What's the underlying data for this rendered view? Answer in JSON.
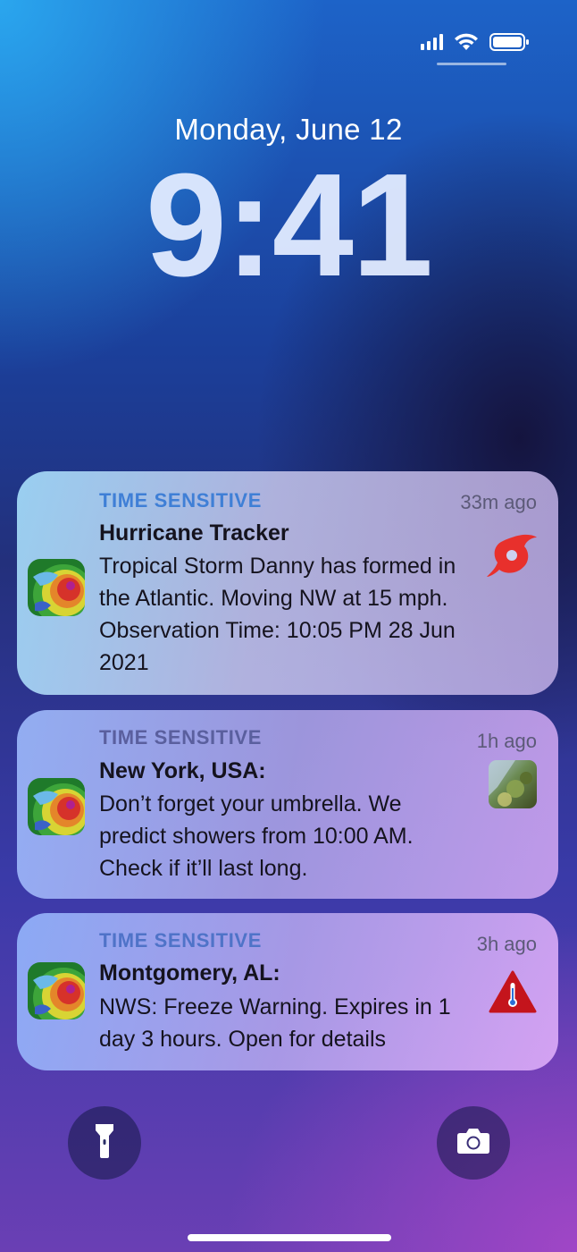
{
  "status_bar": {
    "signal_icon": "cellular-signal-icon",
    "wifi_icon": "wifi-icon",
    "battery_icon": "battery-icon"
  },
  "lock_screen": {
    "date": "Monday, June 12",
    "time": "9:41"
  },
  "notifications": [
    {
      "label": "TIME SENSITIVE",
      "ago": "33m ago",
      "title": "Hurricane Tracker",
      "body": "Tropical Storm Danny has formed in the Atlantic. Moving NW at 15 mph. Observation Time: 10:05 PM 28 Jun 2021",
      "thumbnail": "hurricane-icon",
      "thumbnail_color": "#e8302c"
    },
    {
      "label": "TIME SENSITIVE",
      "ago": "1h ago",
      "title": "New York, USA:",
      "body": "Don’t forget your umbrella. We predict showers from 10:00 AM. Check if it’ll last long.",
      "thumbnail": "rain-photo"
    },
    {
      "label": "TIME SENSITIVE",
      "ago": "3h ago",
      "title": "Montgomery, AL:",
      "body": "NWS: Freeze Warning. Expires in 1 day 3 hours. Open for details",
      "thumbnail": "freeze-warning-icon",
      "thumbnail_color": "#c4141c"
    }
  ],
  "bottom_controls": {
    "left": "flashlight-icon",
    "right": "camera-icon"
  }
}
